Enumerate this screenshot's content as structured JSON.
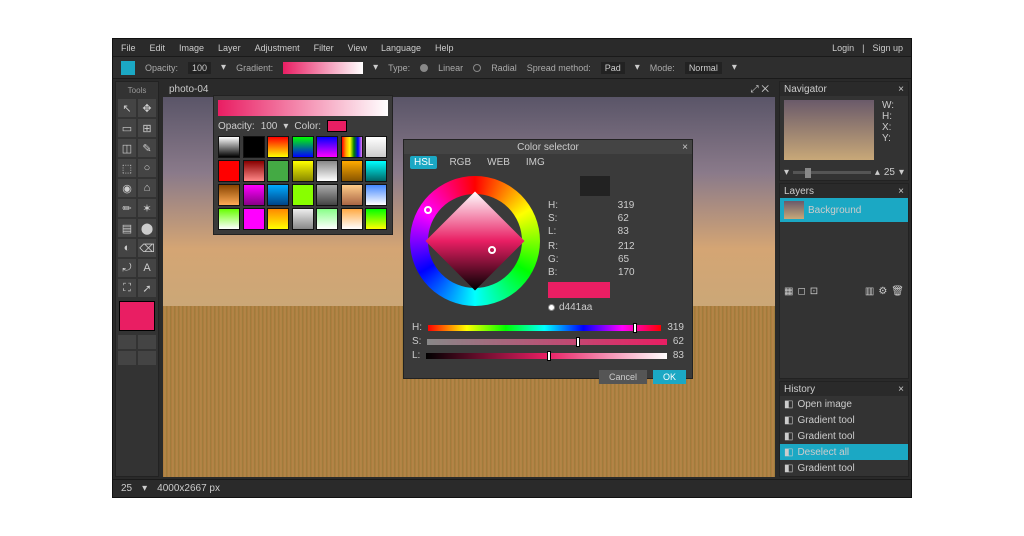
{
  "menu": {
    "items": [
      "File",
      "Edit",
      "Image",
      "Layer",
      "Adjustment",
      "Filter",
      "View",
      "Language",
      "Help"
    ],
    "login": "Login",
    "signup": "Sign up"
  },
  "optbar": {
    "opacity_lbl": "Opacity:",
    "opacity": "100",
    "gradient_lbl": "Gradient:",
    "type_lbl": "Type:",
    "linear": "Linear",
    "radial": "Radial",
    "spread_lbl": "Spread method:",
    "spread": "Pad",
    "mode_lbl": "Mode:",
    "mode": "Normal"
  },
  "tab": {
    "title": "photo-04"
  },
  "toolbox": {
    "title": "Tools",
    "tools": [
      "↖",
      "✥",
      "▭",
      "⊞",
      "◫",
      "✎",
      "⬚",
      "○",
      "◉",
      "⌂",
      "✏",
      "✶",
      "▤",
      "⬤",
      "◐",
      "⌫",
      "⤾",
      "A",
      "⛶",
      "➚"
    ]
  },
  "grad_popup": {
    "opacity_lbl": "Opacity:",
    "opacity": "100",
    "color_lbl": "Color:",
    "swatches": [
      "linear-gradient(#fff,#000)",
      "#000",
      "linear-gradient(#f00,#ff0)",
      "linear-gradient(#0f0,#00f)",
      "linear-gradient(#00f,#f0f)",
      "linear-gradient(90deg,red,orange,yellow,green,blue,violet)",
      "linear-gradient(#fff,#ccc)",
      "#f00",
      "linear-gradient(#800,#f88)",
      "#4a4",
      "linear-gradient(#ff0,#880)",
      "linear-gradient(#888,#fff)",
      "linear-gradient(#fa0,#850)",
      "linear-gradient(#0ff,#066)",
      "linear-gradient(#840,#fa5)",
      "linear-gradient(#f0f,#808)",
      "linear-gradient(#0af,#048)",
      "#8f0",
      "linear-gradient(#aaa,#444)",
      "linear-gradient(#fc8,#a64)",
      "linear-gradient(#48f,#fff)",
      "linear-gradient(#6f0,#fff)",
      "#f0f",
      "linear-gradient(#f80,#ff0)",
      "linear-gradient(#eee,#888)",
      "linear-gradient(#8f8,#fff)",
      "linear-gradient(#fa4,#fff)",
      "linear-gradient(#0f0,#ff0)"
    ]
  },
  "color_popup": {
    "title": "Color selector",
    "tabs": [
      "HSL",
      "RGB",
      "WEB",
      "IMG"
    ],
    "active_tab": 0,
    "h_lbl": "H:",
    "s_lbl": "S:",
    "l_lbl": "L:",
    "h": "319",
    "s": "62",
    "l": "83",
    "r_lbl": "R:",
    "g_lbl": "G:",
    "b_lbl": "B:",
    "r": "212",
    "g": "65",
    "b": "170",
    "hex": "d441aa",
    "cancel": "Cancel",
    "ok": "OK",
    "prev_old": "#000",
    "prev_new": "#e91e63"
  },
  "navigator": {
    "title": "Navigator",
    "zoom": "25",
    "labels": [
      "W:",
      "H:",
      "X:",
      "Y:"
    ]
  },
  "layers": {
    "title": "Layers",
    "item": "Background"
  },
  "history": {
    "title": "History",
    "items": [
      "Open image",
      "Gradient tool",
      "Gradient tool",
      "Deselect all",
      "Gradient tool"
    ],
    "active": 3
  },
  "status": {
    "zoom": "25",
    "dims": "4000x2667 px"
  },
  "colors": {
    "accent": "#1ba8c4",
    "swatch": "#e91e63"
  }
}
